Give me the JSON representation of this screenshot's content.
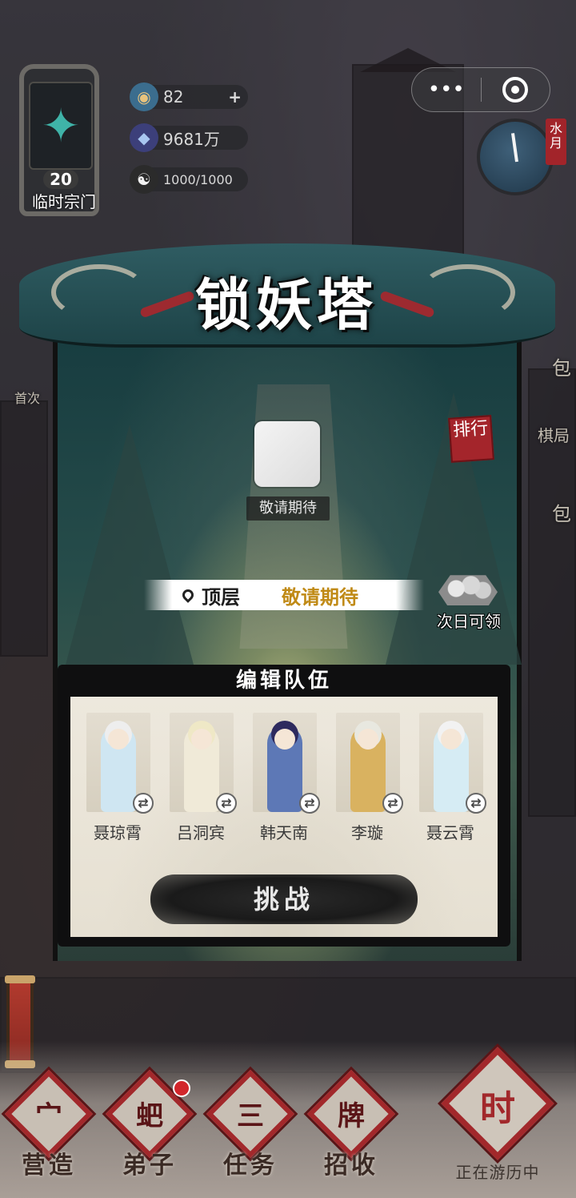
{
  "sect": {
    "level": "20",
    "name": "临时宗门",
    "emblem_icon": "sword-emblem-icon"
  },
  "resources": [
    {
      "icon": "spirit-orb-icon",
      "value": "82",
      "has_plus": true
    },
    {
      "icon": "gem-icon",
      "value": "9681万",
      "has_plus": false
    },
    {
      "icon": "yin-yang-icon",
      "value": "1000/1000",
      "has_plus": false
    }
  ],
  "capsule": {
    "more": "•••",
    "close_icon": "target-icon"
  },
  "clock": {
    "tag": "水月"
  },
  "side_labels": {
    "first": "首次",
    "bag1": "包",
    "chess": "棋局",
    "bag2": "包"
  },
  "tower": {
    "title": "锁妖塔",
    "rank": "排行",
    "floor_caption": "敬请期待",
    "floor_label": "顶层",
    "floor_value": "敬请期待",
    "reward_text": "次日可领"
  },
  "team": {
    "header": "编辑队伍",
    "members": [
      {
        "name": "聂琼霄",
        "hair": "#eeeeee",
        "robe": "#cfe6f2"
      },
      {
        "name": "吕洞宾",
        "hair": "#efe8c6",
        "robe": "#f0ead8"
      },
      {
        "name": "韩天南",
        "hair": "#2d2a5e",
        "robe": "#5d78b6"
      },
      {
        "name": "李璇",
        "hair": "#e8e8e0",
        "robe": "#d9b260"
      },
      {
        "name": "聂云霄",
        "hair": "#f2f2f2",
        "robe": "#d6ecf4"
      }
    ],
    "challenge_label": "挑战"
  },
  "nav": [
    {
      "label": "营造",
      "glyph": "宀"
    },
    {
      "label": "弟子",
      "glyph": "蚆"
    },
    {
      "label": "任务",
      "glyph": "三"
    },
    {
      "label": "招收",
      "glyph": "牌"
    }
  ],
  "travel": {
    "glyph": "时",
    "label": "正在游历中"
  },
  "colors": {
    "accent_red": "#a2282b",
    "gold": "#c08a16",
    "teal": "#2f5c62"
  }
}
